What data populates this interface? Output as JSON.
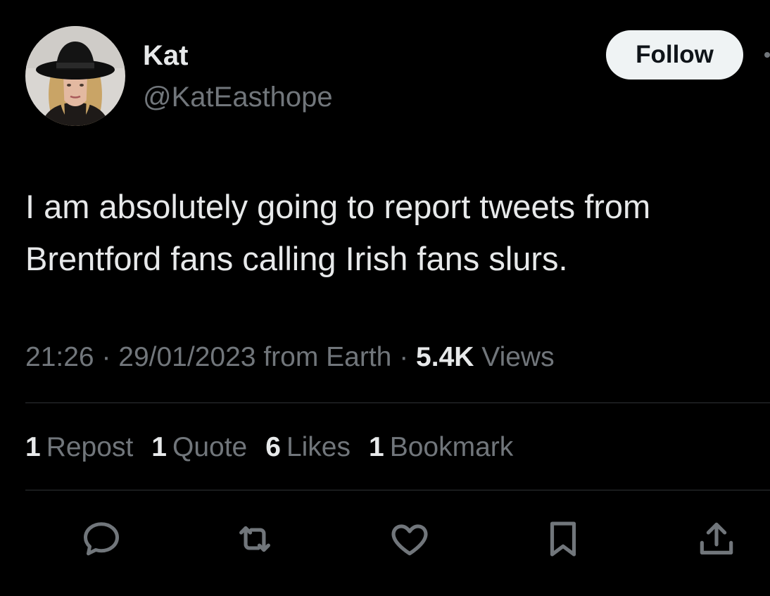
{
  "author": {
    "display_name": "Kat",
    "handle": "@KatEasthope"
  },
  "follow_button": {
    "label": "Follow"
  },
  "tweet": {
    "text_line1": "I am absolutely going to report tweets from",
    "text_line2": "Brentford fans calling Irish fans slurs."
  },
  "meta": {
    "time": "21:26",
    "sep1": " · ",
    "date": "29/01/2023",
    "source": " from Earth",
    "sep2": " · ",
    "views_count": "5.4K",
    "views_label": " Views"
  },
  "stats": [
    {
      "count": "1",
      "label": "Repost"
    },
    {
      "count": "1",
      "label": "Quote"
    },
    {
      "count": "6",
      "label": "Likes"
    },
    {
      "count": "1",
      "label": "Bookmark"
    }
  ],
  "actions": [
    "reply-icon",
    "repost-icon",
    "like-icon",
    "bookmark-icon",
    "share-icon"
  ],
  "colors": {
    "background": "#000000",
    "text_primary": "#e7e9ea",
    "text_secondary": "#71767b",
    "divider": "#2f3336",
    "follow_bg": "#eff3f4"
  }
}
